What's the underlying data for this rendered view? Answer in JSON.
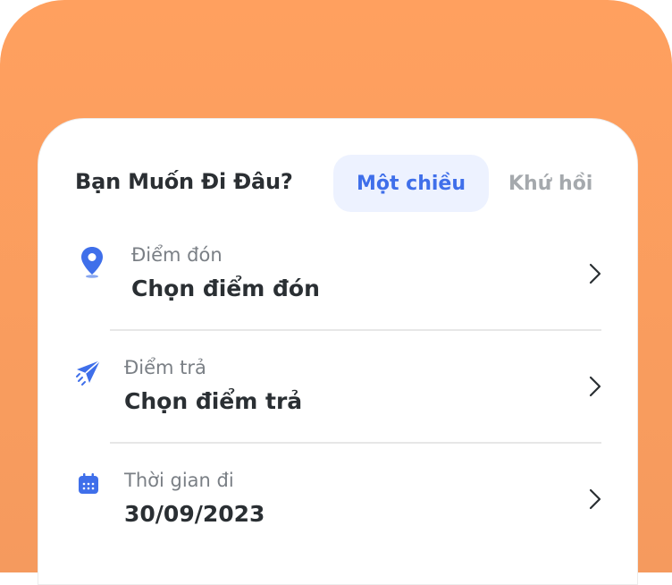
{
  "header": {
    "title": "Bạn Muốn Đi Đâu?",
    "trip_one_way": "Một chiều",
    "trip_round": "Khứ hồi"
  },
  "fields": {
    "pickup": {
      "label": "Điểm đón",
      "value": "Chọn điểm đón",
      "icon": "map-pin-icon"
    },
    "dropoff": {
      "label": "Điểm trả",
      "value": "Chọn điểm trả",
      "icon": "send-icon"
    },
    "depart": {
      "label": "Thời gian đi",
      "value": "30/09/2023",
      "icon": "calendar-icon"
    }
  },
  "colors": {
    "background": "#ffa05f",
    "accent": "#3f6fea",
    "toggle_active_bg": "#edf2ff",
    "inactive_text": "#a5a9ad"
  }
}
